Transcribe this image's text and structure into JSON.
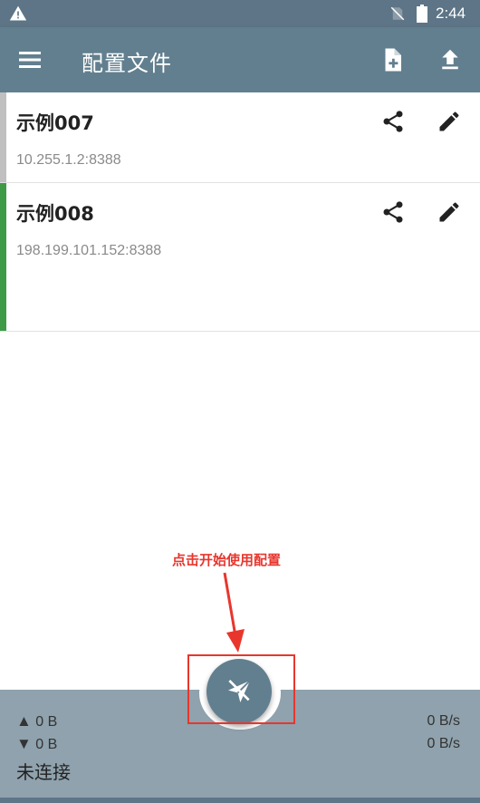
{
  "statusbar": {
    "time": "2:44",
    "icons": [
      "warning-icon",
      "no-sim-icon",
      "battery-icon"
    ]
  },
  "appbar": {
    "title": "配置文件",
    "icons": [
      "menu-icon",
      "new-file-icon",
      "upload-icon"
    ]
  },
  "profiles": [
    {
      "name": "示例007",
      "address": "10.255.1.2:8388",
      "accent": "#c0c0c0"
    },
    {
      "name": "示例008",
      "address": "198.199.101.152:8388",
      "accent": "#3e9a46"
    }
  ],
  "callout": {
    "text": "点击开始使用配置",
    "color": "#e8362d"
  },
  "traffic": {
    "upload_icon": "▲",
    "upload_total": "0 B",
    "download_icon": "▼",
    "download_total": "0 B",
    "upload_rate": "0 B/s",
    "download_rate": "0 B/s",
    "connection_status": "未连接"
  },
  "colors": {
    "primary": "#627f8f",
    "statusbar": "#5d7586",
    "bottom_bar": "#8fa2ad"
  }
}
